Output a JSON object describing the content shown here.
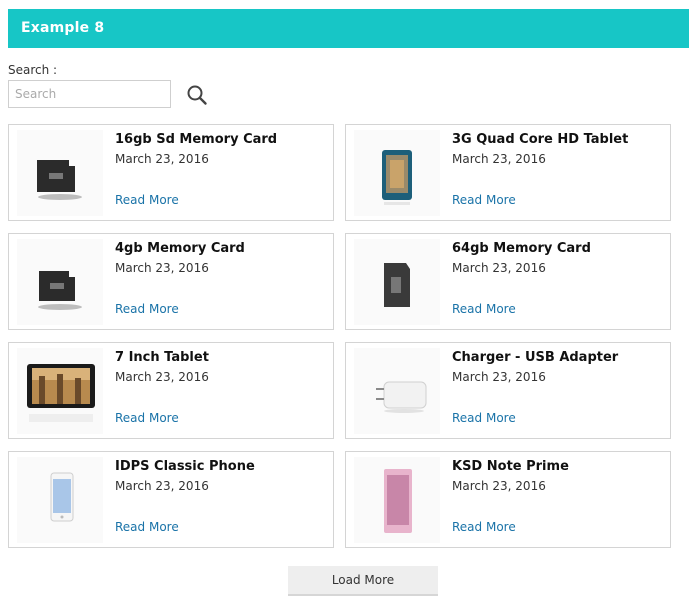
{
  "header": {
    "title": "Example 8"
  },
  "search": {
    "label": "Search :",
    "placeholder": "Search",
    "value": ""
  },
  "products": [
    {
      "title": "16gb Sd Memory Card",
      "date": "March 23, 2016",
      "link": "Read More",
      "thumb": "microsd-card-16gb-icon"
    },
    {
      "title": "3G Quad Core HD Tablet",
      "date": "March 23, 2016",
      "link": "Read More",
      "thumb": "tablet-icon"
    },
    {
      "title": "4gb Memory Card",
      "date": "March 23, 2016",
      "link": "Read More",
      "thumb": "microsd-card-4gb-icon"
    },
    {
      "title": "64gb Memory Card",
      "date": "March 23, 2016",
      "link": "Read More",
      "thumb": "microsd-card-64gb-icon"
    },
    {
      "title": "7 Inch Tablet",
      "date": "March 23, 2016",
      "link": "Read More",
      "thumb": "seven-inch-tablet-icon"
    },
    {
      "title": "Charger - USB Adapter",
      "date": "March 23, 2016",
      "link": "Read More",
      "thumb": "usb-charger-icon"
    },
    {
      "title": "IDPS Classic Phone",
      "date": "March 23, 2016",
      "link": "Read More",
      "thumb": "white-phone-icon"
    },
    {
      "title": "KSD Note Prime",
      "date": "March 23, 2016",
      "link": "Read More",
      "thumb": "pink-phone-icon"
    }
  ],
  "load_more": {
    "label": "Load More"
  },
  "colors": {
    "header_bg": "#17c6c6",
    "link": "#1a73a8"
  }
}
